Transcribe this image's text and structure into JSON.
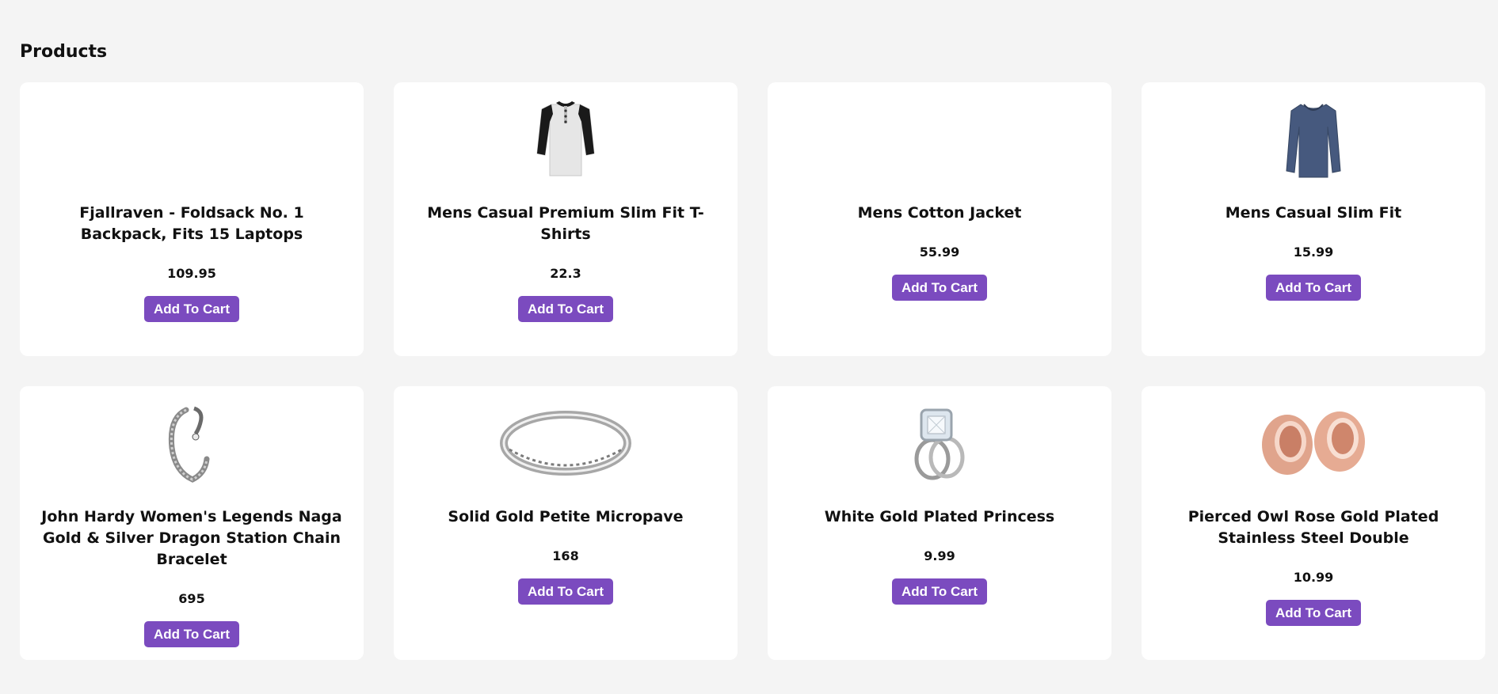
{
  "page": {
    "title": "Products"
  },
  "products": [
    {
      "name": "Fjallraven - Foldsack No. 1 Backpack, Fits 15 Laptops",
      "price": "109.95",
      "button": "Add To Cart",
      "image_icon": "empty-image"
    },
    {
      "name": "Mens Casual Premium Slim Fit T-Shirts",
      "price": "22.3",
      "button": "Add To Cart",
      "image_icon": "raglan-tshirt-image"
    },
    {
      "name": "Mens Cotton Jacket",
      "price": "55.99",
      "button": "Add To Cart",
      "image_icon": "empty-image"
    },
    {
      "name": "Mens Casual Slim Fit",
      "price": "15.99",
      "button": "Add To Cart",
      "image_icon": "longsleeve-shirt-image"
    },
    {
      "name": "John Hardy Women's Legends Naga Gold & Silver Dragon Station Chain Bracelet",
      "price": "695",
      "button": "Add To Cart",
      "image_icon": "bracelet-image"
    },
    {
      "name": "Solid Gold Petite Micropave",
      "price": "168",
      "button": "Add To Cart",
      "image_icon": "ring-image"
    },
    {
      "name": "White Gold Plated Princess",
      "price": "9.99",
      "button": "Add To Cart",
      "image_icon": "diamond-ring-image"
    },
    {
      "name": "Pierced Owl Rose Gold Plated Stainless Steel Double",
      "price": "10.99",
      "button": "Add To Cart",
      "image_icon": "rose-gold-plugs-image"
    }
  ],
  "colors": {
    "background": "#f4f4f4",
    "card": "#ffffff",
    "button": "#7b4bbf",
    "button_text": "#ffffff"
  }
}
